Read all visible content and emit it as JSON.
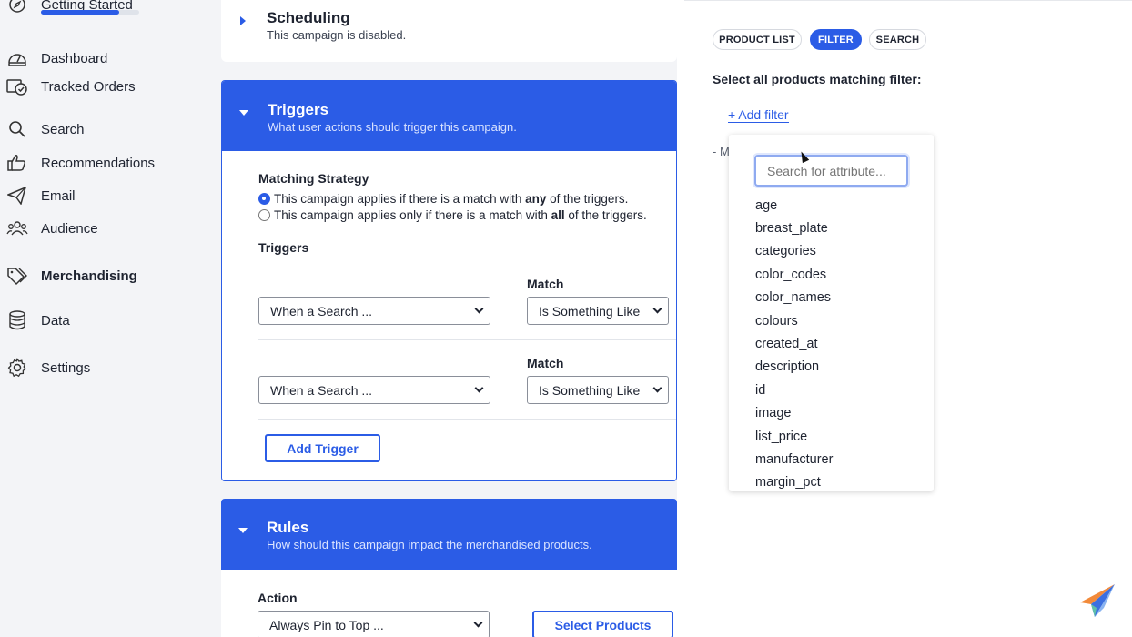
{
  "sidebar": {
    "getting_started": {
      "label": "Getting Started",
      "progress": 0.8
    },
    "items": [
      {
        "label": "Dashboard",
        "icon": "dashboard-icon"
      },
      {
        "label": "Tracked Orders",
        "icon": "tracked-orders-icon"
      },
      {
        "label": "Search",
        "icon": "search-icon"
      },
      {
        "label": "Recommendations",
        "icon": "thumbs-up-icon"
      },
      {
        "label": "Email",
        "icon": "send-icon"
      },
      {
        "label": "Audience",
        "icon": "audience-icon"
      },
      {
        "label": "Merchandising",
        "icon": "tag-icon",
        "active": true
      },
      {
        "label": "Data",
        "icon": "database-icon"
      },
      {
        "label": "Settings",
        "icon": "gear-icon"
      }
    ]
  },
  "scheduling": {
    "title": "Scheduling",
    "subtitle": "This campaign is disabled."
  },
  "triggers": {
    "title": "Triggers",
    "subtitle": "What user actions should trigger this campaign.",
    "matching_strategy_label": "Matching Strategy",
    "option_any": {
      "before": "This campaign applies if there is a match with ",
      "bold": "any",
      "after": " of the triggers.",
      "selected": true
    },
    "option_all": {
      "before": "This campaign applies only if there is a match with ",
      "bold": "all",
      "after": " of the triggers.",
      "selected": false
    },
    "triggers_label": "Triggers",
    "rows": [
      {
        "match_label": "Match",
        "trigger_value": "When a Search ...",
        "match_value": "Is Something Like"
      },
      {
        "match_label": "Match",
        "trigger_value": "When a Search ...",
        "match_value": "Is Something Like"
      }
    ],
    "add_trigger_label": "Add Trigger"
  },
  "rules": {
    "title": "Rules",
    "subtitle": "How should this campaign impact the merchandised products.",
    "action_label": "Action",
    "action_value": "Always Pin to Top ...",
    "select_products_label": "Select Products"
  },
  "panel": {
    "tabs": [
      {
        "label": "PRODUCT LIST",
        "active": false
      },
      {
        "label": "FILTER",
        "active": true
      },
      {
        "label": "SEARCH",
        "active": false
      }
    ],
    "heading": "Select all products matching filter:",
    "add_filter_label": "+ Add filter",
    "partial_text": "- M",
    "search_placeholder": "Search for attribute...",
    "attributes": [
      "age",
      "breast_plate",
      "categories",
      "color_codes",
      "color_names",
      "colours",
      "created_at",
      "description",
      "id",
      "image",
      "list_price",
      "manufacturer",
      "margin_pct"
    ]
  },
  "colors": {
    "accent": "#2b5ce6",
    "background": "#f3f4f7"
  }
}
